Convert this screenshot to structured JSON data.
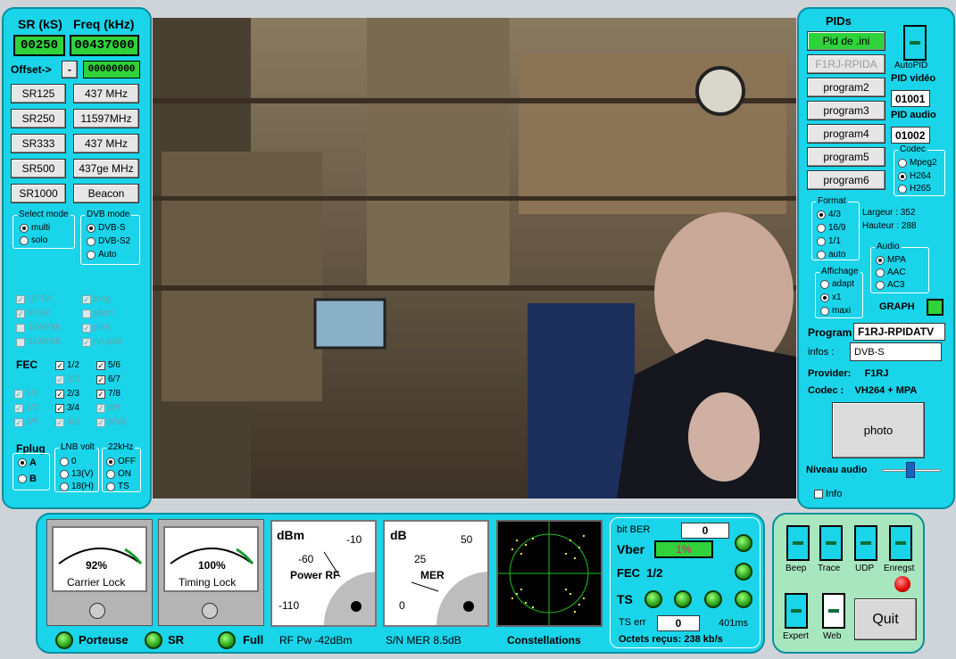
{
  "left": {
    "sr_label": "SR (kS)",
    "freq_label": "Freq (kHz)",
    "sr_value": "00250",
    "freq_value": "00437000",
    "offset_label": "Offset->",
    "offset_minus": "-",
    "offset_value": "00000000",
    "sr_buttons": [
      "SR125",
      "SR250",
      "SR333",
      "SR500",
      "SR1000"
    ],
    "freq_buttons": [
      "437 MHz",
      "11597MHz",
      "437 MHz",
      "437ge MHz",
      "Beacon"
    ],
    "select_mode": {
      "title": "Select mode",
      "options": [
        "multi",
        "solo"
      ]
    },
    "dvb_mode": {
      "title": "DVB mode",
      "options": [
        "DVB-S",
        "DVB-S2",
        "Auto"
      ]
    },
    "modulations": [
      "QPSK",
      "8PSK",
      "16APSK",
      "32APSK"
    ],
    "frames": [
      "long",
      "short",
      "pilot",
      "no pilot"
    ],
    "fec_label": "FEC",
    "fec_col1": [
      "1/4",
      "1/3",
      "2/5"
    ],
    "fec_col2": [
      "1/2",
      "3/5",
      "2/3",
      "3/4",
      "4/5"
    ],
    "fec_col3": [
      "5/6",
      "6/7",
      "7/8",
      "8/9",
      "9/10"
    ],
    "fplug": {
      "title": "Fplug",
      "options": [
        "A",
        "B"
      ]
    },
    "lnb": {
      "title": "LNB volt",
      "options": [
        "0",
        "13(V)",
        "18(H)"
      ]
    },
    "khz": {
      "title": "22kHz",
      "options": [
        "OFF",
        "ON",
        "TS"
      ]
    }
  },
  "right": {
    "title": "PIDs",
    "buttons": [
      "Pid de .ini",
      "F1RJ-RPIDA",
      "program2",
      "program3",
      "program4",
      "program5",
      "program6"
    ],
    "autopid": "AutoPID",
    "pid_video_label": "PID vidéo",
    "pid_video": "01001",
    "pid_audio_label": "PID audio",
    "pid_audio": "01002",
    "codec": {
      "title": "Codec",
      "options": [
        "Mpeg2",
        "H264",
        "H265"
      ]
    },
    "format": {
      "title": "Format",
      "options": [
        "4/3",
        "16/9",
        "1/1",
        "auto"
      ]
    },
    "largeur": "Largeur :  352",
    "hauteur": "Hauteur :  288",
    "audio": {
      "title": "Audio",
      "options": [
        "MPA",
        "AAC",
        "AC3"
      ]
    },
    "affichage": {
      "title": "Affichage",
      "options": [
        "adapt",
        "x1",
        "maxi"
      ]
    },
    "graph": "GRAPH",
    "program_label": "Program",
    "program_value": "F1RJ-RPIDATV",
    "infos_label": "infos :",
    "infos_value": "DVB-S",
    "provider": "Provider:     F1RJ",
    "codec_line": "Codec :    VH264 + MPA",
    "photo": "photo",
    "niveau": "Niveau audio",
    "info": "Info"
  },
  "bottom": {
    "carrier": {
      "value": "92%",
      "label": "Carrier Lock"
    },
    "timing": {
      "value": "100%",
      "label": "Timing Lock"
    },
    "power": {
      "unit": "dBm",
      "label": "Power RF",
      "ticks": [
        "-10",
        "-60",
        "-110"
      ]
    },
    "mer": {
      "unit": "dB",
      "label": "MER",
      "ticks": [
        "50",
        "25",
        "0"
      ]
    },
    "status": [
      "Porteuse",
      "SR",
      "Full"
    ],
    "rf_pw": "RF Pw -42dBm",
    "sn_mer": "S/N MER 8.5dB",
    "constellations": "Constellations",
    "bit_ber_label": "bit BER",
    "bit_ber": "0",
    "vber_label": "Vber",
    "vber": "1%",
    "fec": "FEC  1/2",
    "ts": "TS",
    "ts_err_label": "TS err",
    "ts_err": "0",
    "ms": "401ms",
    "octets": "Octets reçus: 238 kb/s"
  },
  "controls": {
    "beep": "Beep",
    "trace": "Trace",
    "udp": "UDP",
    "enreg": "Enregst",
    "expert": "Expert",
    "web": "Web",
    "quit": "Quit"
  }
}
